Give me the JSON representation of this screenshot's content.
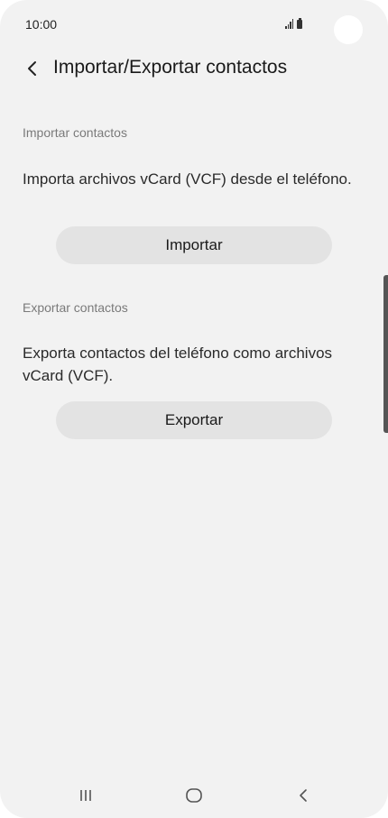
{
  "status_bar": {
    "time": "10:00"
  },
  "header": {
    "back_icon": "chevron-left-icon",
    "title": "Importar/Exportar contactos"
  },
  "import_section": {
    "header": "Importar contactos",
    "description": "Importa archivos vCard (VCF) desde el teléfono.",
    "button_label": "Importar"
  },
  "export_section": {
    "header": "Exportar contactos",
    "description": "Exporta contactos del teléfono como archivos vCard (VCF).",
    "button_label": "Exportar"
  },
  "nav_bar": {
    "recents_icon": "recents-icon",
    "home_icon": "home-icon",
    "back_icon": "back-icon"
  },
  "colors": {
    "background": "#f2f2f2",
    "button_bg": "#e3e3e3",
    "section_header": "#7a7a7a",
    "text": "#1a1a1a"
  }
}
